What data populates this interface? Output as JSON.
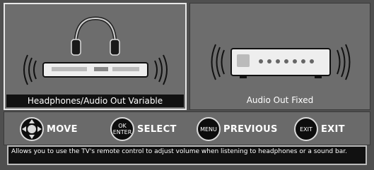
{
  "options": [
    {
      "label": "Headphones/Audio Out Variable",
      "icon": "headphones-soundbar-icon",
      "selected": true
    },
    {
      "label": "Audio Out Fixed",
      "icon": "audio-receiver-icon",
      "selected": false
    }
  ],
  "controls": {
    "move": {
      "label": "MOVE",
      "icon": "dpad-icon"
    },
    "select": {
      "label": "SELECT",
      "btn_top": "OK",
      "btn_bottom": "ENTER"
    },
    "previous": {
      "label": "PREVIOUS",
      "btn": "MENU"
    },
    "exit": {
      "label": "EXIT",
      "btn": "EXIT"
    }
  },
  "help_text": "Allows you to use the TV's remote control to adjust volume when listening to headphones or a sound bar.",
  "colors": {
    "background": "#4f4f4f",
    "tile": "#6d6d6d",
    "selected_label_bg": "#111111"
  }
}
